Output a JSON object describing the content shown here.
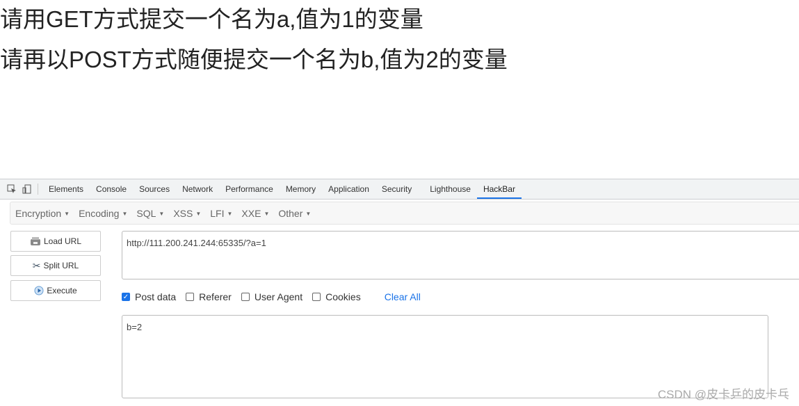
{
  "page": {
    "line1": "请用GET方式提交一个名为a,值为1的变量",
    "line2": "请再以POST方式随便提交一个名为b,值为2的变量"
  },
  "devtools": {
    "tabs": [
      "Elements",
      "Console",
      "Sources",
      "Network",
      "Performance",
      "Memory",
      "Application",
      "Security",
      "Lighthouse",
      "HackBar"
    ],
    "active_tab": "HackBar",
    "accent": "#1a73e8"
  },
  "hackbar": {
    "menus": [
      "Encryption",
      "Encoding",
      "SQL",
      "XSS",
      "LFI",
      "XXE",
      "Other"
    ],
    "buttons": {
      "load": "Load URL",
      "split": "Split URL",
      "execute": "Execute"
    },
    "url": "http://111.200.241.244:65335/?a=1",
    "options": [
      {
        "label": "Post data",
        "checked": true
      },
      {
        "label": "Referer",
        "checked": false
      },
      {
        "label": "User Agent",
        "checked": false
      },
      {
        "label": "Cookies",
        "checked": false
      }
    ],
    "clear_all": "Clear All",
    "post_data": "b=2"
  },
  "watermark": "CSDN @皮卡乒的皮卡乓"
}
